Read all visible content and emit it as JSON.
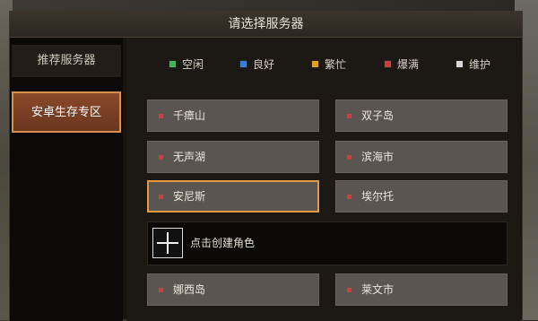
{
  "title": "请选择服务器",
  "sidebar": {
    "recommended_label": "推荐服务器",
    "active_zone_label": "安卓生存专区"
  },
  "legend": [
    {
      "label": "空闲",
      "color": "#3cba54"
    },
    {
      "label": "良好",
      "color": "#3a7fd0"
    },
    {
      "label": "繁忙",
      "color": "#e0a020"
    },
    {
      "label": "爆满",
      "color": "#d23c3c"
    },
    {
      "label": "维护",
      "color": "#d8d8d8"
    }
  ],
  "servers": [
    {
      "name": "千瘴山",
      "status": "爆满"
    },
    {
      "name": "双子岛",
      "status": "爆满"
    },
    {
      "name": "无声湖",
      "status": "爆满"
    },
    {
      "name": "滨海市",
      "status": "爆满"
    },
    {
      "name": "安尼斯",
      "status": "爆满",
      "selected": true
    },
    {
      "name": "埃尔托",
      "status": "爆满"
    },
    {
      "name": "娜西岛",
      "status": "爆满"
    },
    {
      "name": "莱文市",
      "status": "爆满"
    }
  ],
  "create_character": {
    "label": "点击创建角色",
    "icon": "plus-icon"
  }
}
